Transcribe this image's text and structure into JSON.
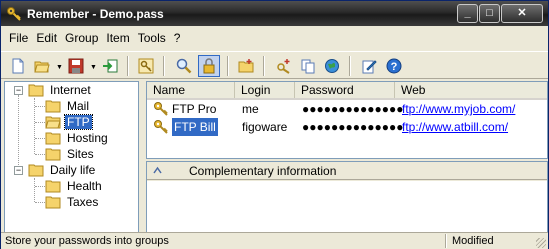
{
  "window": {
    "title": "Remember - Demo.pass",
    "controls": {
      "minimize": "_",
      "maximize": "□",
      "close": "✕"
    }
  },
  "menubar": {
    "items": [
      "File",
      "Edit",
      "Group",
      "Item",
      "Tools",
      "?"
    ]
  },
  "toolbar": {
    "icons": [
      "new-file-icon",
      "open-folder-icon",
      "save-icon",
      "export-icon",
      "key-icon",
      "search-icon",
      "lock-icon",
      "new-group-icon",
      "new-item-icon",
      "copy-icon",
      "web-icon",
      "edit-icon",
      "help-icon"
    ]
  },
  "tree": {
    "groups": [
      {
        "label": "Internet",
        "expanded": true,
        "children": [
          "Mail",
          "FTP",
          "Hosting",
          "Sites"
        ]
      },
      {
        "label": "Daily life",
        "expanded": true,
        "children": [
          "Health",
          "Taxes"
        ]
      }
    ],
    "selected": "FTP"
  },
  "list": {
    "columns": [
      "Name",
      "Login",
      "Password",
      "Web"
    ],
    "rows": [
      {
        "name": "FTP Pro",
        "login": "me",
        "password": "●●●●●●●●●●●●●●",
        "web": "ftp://www.myjob.com/"
      },
      {
        "name": "FTP Bill",
        "login": "figoware",
        "password": "●●●●●●●●●●●●●●",
        "web": "ftp://www.atbill.com/"
      }
    ],
    "selected_row": 1
  },
  "info": {
    "title": "Complementary information"
  },
  "status": {
    "message": "Store your passwords into groups",
    "state": "Modified"
  },
  "colors": {
    "selection": "#316ac5",
    "link": "#0000ff",
    "folder": "#f5d36b"
  }
}
